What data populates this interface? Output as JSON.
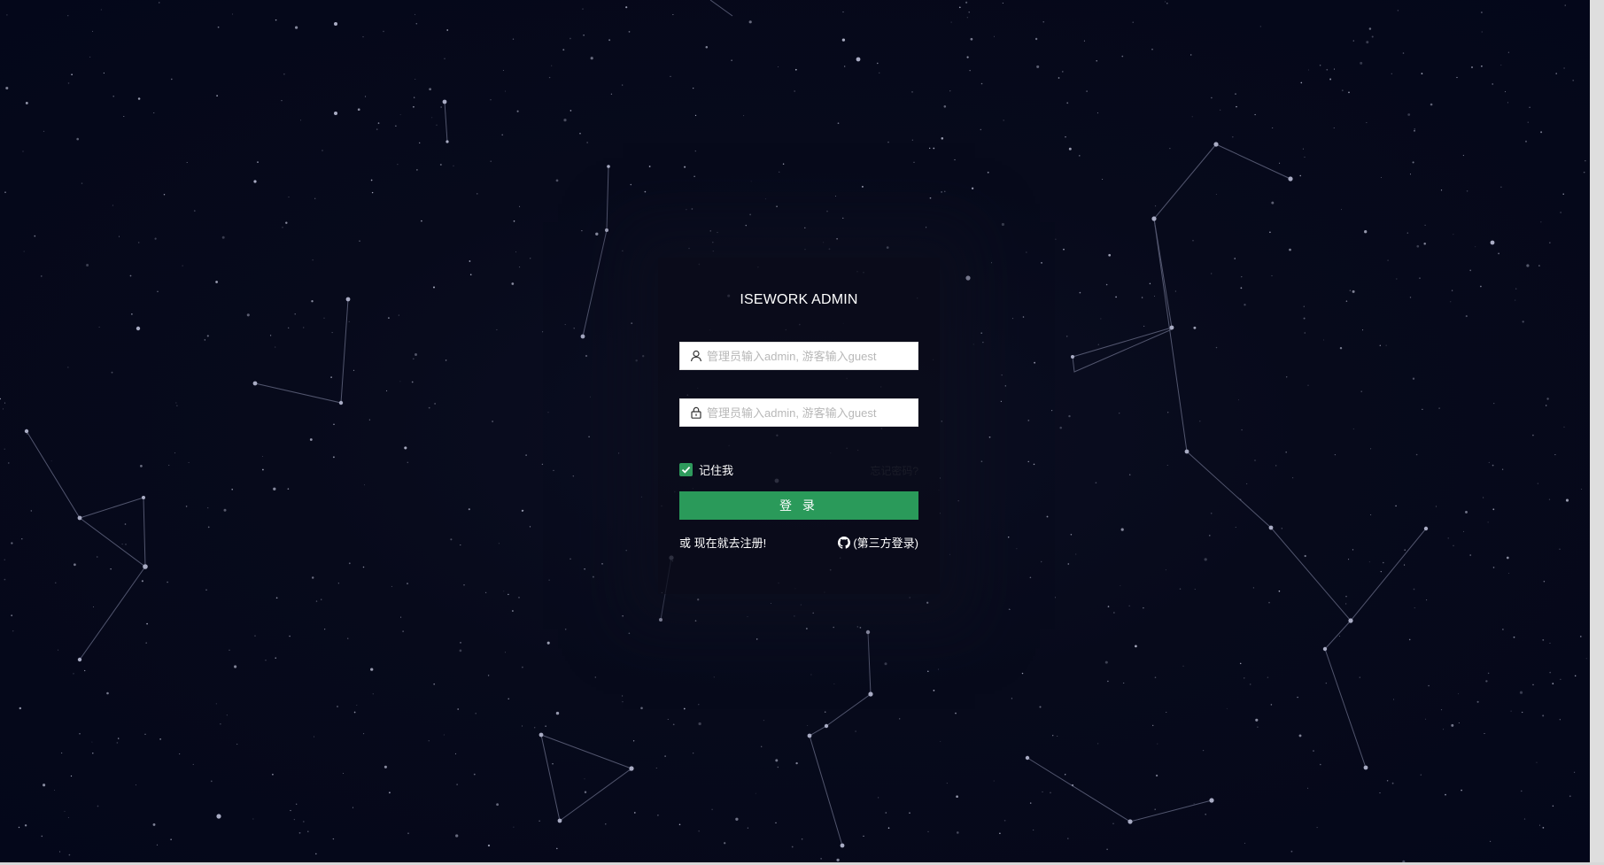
{
  "app": {
    "title": "ISEWORK ADMIN"
  },
  "form": {
    "username_placeholder": "管理员输入admin, 游客输入guest",
    "password_placeholder": "管理员输入admin, 游客输入guest",
    "remember_label": "记住我",
    "remember_checked": true,
    "forgot_label": "忘记密码?",
    "login_button": "登 录",
    "register_link": "或 现在就去注册!",
    "third_party_link": "(第三方登录)"
  },
  "colors": {
    "background": "#050818",
    "accent": "#2a9a5a",
    "panel": "#0a0c1a",
    "text": "#ffffff"
  },
  "icons": {
    "username": "user-icon",
    "password": "lock-icon",
    "checkbox": "check-icon",
    "third_party": "github-icon"
  }
}
